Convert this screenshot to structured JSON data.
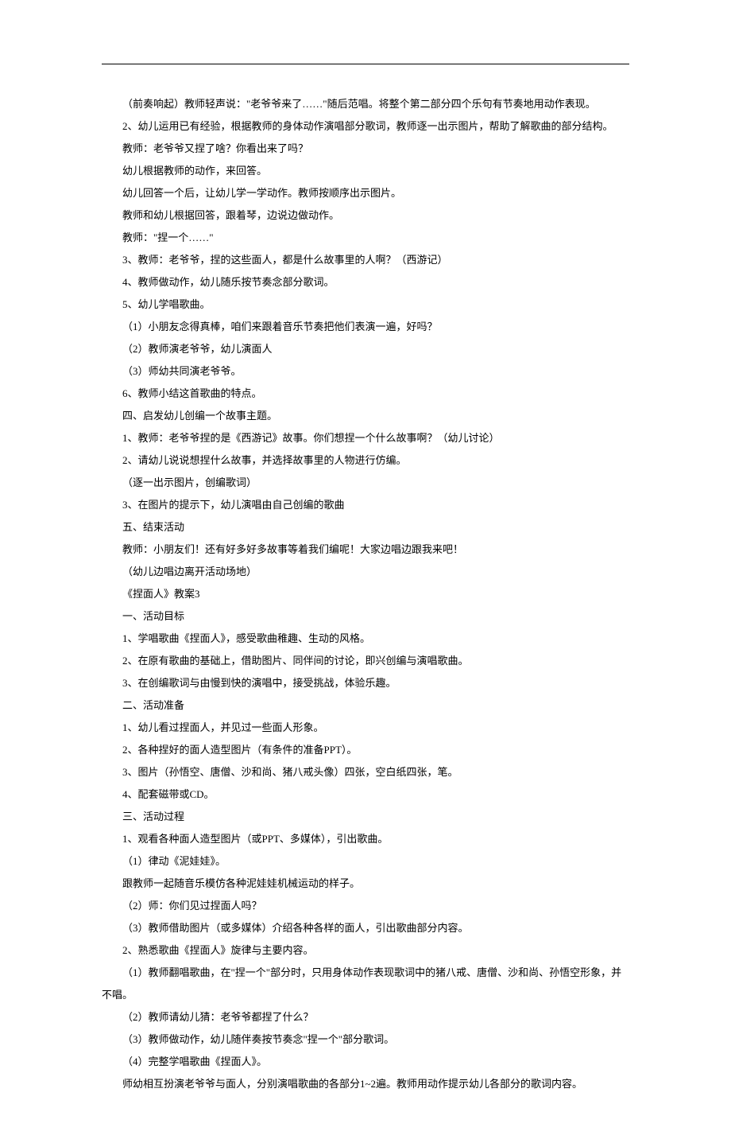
{
  "lines": [
    "（前奏响起）教师轻声说：\"老爷爷来了……\"随后范唱。将整个第二部分四个乐句有节奏地用动作表现。",
    "2、幼儿运用已有经验，根据教师的身体动作演唱部分歌词，教师逐一出示图片，帮助了解歌曲的部分结构。",
    "教师：老爷爷又捏了啥？你看出来了吗？",
    "幼儿根据教师的动作，来回答。",
    "幼儿回答一个后，让幼儿学一学动作。教师按顺序出示图片。",
    "教师和幼儿根据回答，跟着琴，边说边做动作。",
    "教师：\"捏一个……\"",
    "3、教师：老爷爷，捏的这些面人，都是什么故事里的人啊？（西游记）",
    "4、教师做动作，幼儿随乐按节奏念部分歌词。",
    "5、幼儿学唱歌曲。",
    "（1）小朋友念得真棒，咱们来跟着音乐节奏把他们表演一遍，好吗？",
    "（2）教师演老爷爷，幼儿演面人",
    "（3）师幼共同演老爷爷。",
    "6、教师小结这首歌曲的特点。",
    "四、启发幼儿创编一个故事主题。",
    "1、教师：老爷爷捏的是《西游记》故事。你们想捏一个什么故事啊？（幼儿讨论）",
    "2、请幼儿说说想捏什么故事，并选择故事里的人物进行仿编。",
    "（逐一出示图片，创编歌词）",
    "3、在图片的提示下，幼儿演唱由自己创编的歌曲",
    "五、结束活动",
    "教师：小朋友们！还有好多好多故事等着我们编呢！大家边唱边跟我来吧！",
    "（幼儿边唱边离开活动场地）",
    "《捏面人》教案3",
    "一、活动目标",
    "1、学唱歌曲《捏面人》，感受歌曲稚趣、生动的风格。",
    "2、在原有歌曲的基础上，借助图片、同伴间的讨论，即兴创编与演唱歌曲。",
    "3、在创编歌词与由慢到快的演唱中，接受挑战，体验乐趣。",
    "二、活动准备",
    "1、幼儿看过捏面人，并见过一些面人形象。",
    "2、各种捏好的面人造型图片（有条件的准备PPT）。",
    "3、图片（孙悟空、唐僧、沙和尚、猪八戒头像）四张，空白纸四张，笔。",
    "4、配套磁带或CD。",
    "三、活动过程",
    "1、观看各种面人造型图片（或PPT、多媒体），引出歌曲。",
    "（1）律动《泥娃娃》。",
    "跟教师一起随音乐模仿各种泥娃娃机械运动的样子。",
    "（2）师：你们见过捏面人吗？",
    "（3）教师借助图片（或多媒体）介绍各种各样的面人，引出歌曲部分内容。",
    "2、熟悉歌曲《捏面人》旋律与主要内容。",
    "（1）教师翻唱歌曲，在\"捏一个\"部分时，只用身体动作表现歌词中的猪八戒、唐僧、沙和尚、孙悟空形象，并不唱。",
    "（2）教师请幼儿猜：老爷爷都捏了什么？",
    "（3）教师做动作，幼儿随伴奏按节奏念\"捏一个\"部分歌词。",
    "（4）完整学唱歌曲《捏面人》。",
    "师幼相互扮演老爷爷与面人，分别演唱歌曲的各部分1~2遍。教师用动作提示幼儿各部分的歌词内容。"
  ]
}
